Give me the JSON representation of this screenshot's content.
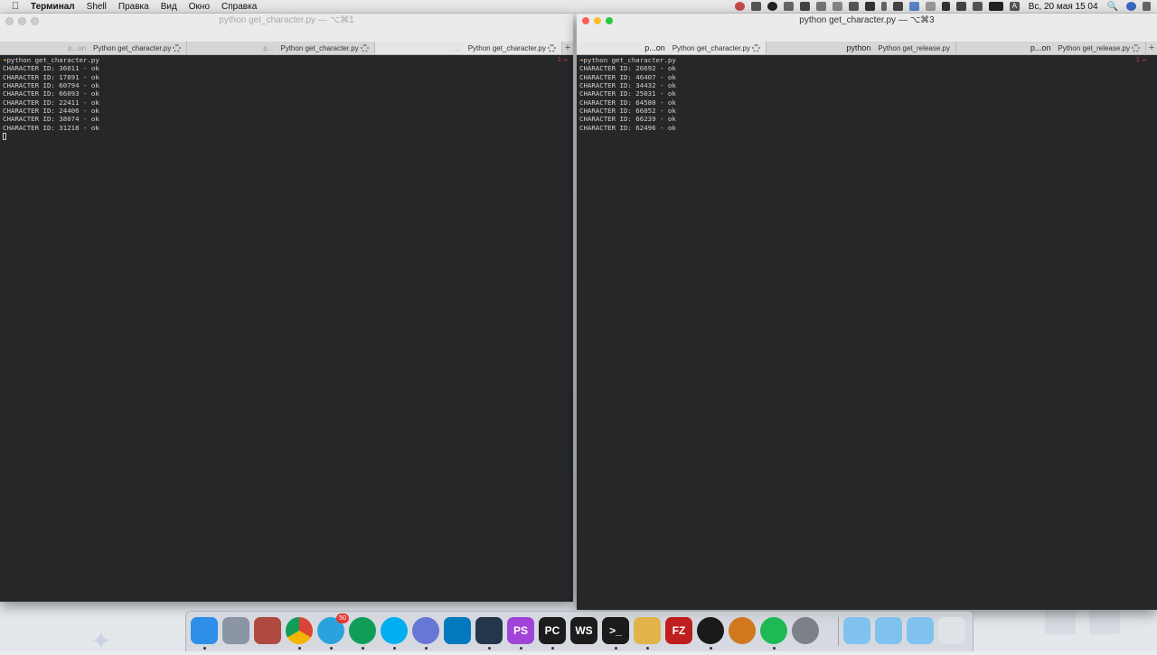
{
  "menubar": {
    "app_name": "Терминал",
    "items": [
      "Shell",
      "Правка",
      "Вид",
      "Окно",
      "Справка"
    ],
    "clock": "Вс, 20 мая  15 04",
    "keyboard_layout": "A"
  },
  "window_left": {
    "title": "python get_character.py — ⌥⌘1",
    "tabs": [
      {
        "short": "p...on",
        "label": "Python get_character.py"
      },
      {
        "short": "p...",
        "label": "Python get_character.py"
      },
      {
        "short": "...",
        "label": "Python get_character.py"
      }
    ],
    "line_number": "1",
    "prompt": "python get_character.py",
    "output": [
      "CHARACTER ID: 36011 - ok",
      "CHARACTER ID: 17891 - ok",
      "CHARACTER ID: 60794 - ok",
      "CHARACTER ID: 66093 - ok",
      "CHARACTER ID: 22411 - ok",
      "CHARACTER ID: 24406 - ok",
      "CHARACTER ID: 38074 - ok",
      "CHARACTER ID: 31218 - ok"
    ]
  },
  "window_right": {
    "title": "python get_character.py — ⌥⌘3",
    "tabs": [
      {
        "short": "p...on",
        "label": "Python get_character.py"
      },
      {
        "short": "python",
        "label": "Python get_release.py"
      },
      {
        "short": "p...on",
        "label": "Python get_release.py"
      }
    ],
    "line_number": "1",
    "prompt": "python get_character.py",
    "output": [
      "CHARACTER ID: 26692 - ok",
      "CHARACTER ID: 46407 - ok",
      "CHARACTER ID: 34432 - ok",
      "CHARACTER ID: 25031 - ok",
      "CHARACTER ID: 64580 - ok",
      "CHARACTER ID: 66852 - ok",
      "CHARACTER ID: 66239 - ok",
      "CHARACTER ID: 62496 - ok"
    ]
  },
  "dock": {
    "telegram_badge": "50",
    "apps": [
      {
        "name": "finder",
        "color": "#2f8fe8"
      },
      {
        "name": "launchpad",
        "color": "#8c95a3"
      },
      {
        "name": "preview-tool",
        "color": "#b04a40"
      },
      {
        "name": "chrome",
        "color": "#f2f2f2"
      },
      {
        "name": "telegram",
        "color": "#2aa3dd"
      },
      {
        "name": "hangouts",
        "color": "#0f9d58"
      },
      {
        "name": "skype",
        "color": "#00aff0"
      },
      {
        "name": "discord",
        "color": "#6677d4"
      },
      {
        "name": "trello",
        "color": "#0079bf"
      },
      {
        "name": "vscode",
        "color": "#24364a"
      },
      {
        "name": "phpstorm",
        "color": "#a044d8"
      },
      {
        "name": "pycharm",
        "color": "#1c1c1c"
      },
      {
        "name": "webstorm",
        "color": "#1c1c1c"
      },
      {
        "name": "terminal",
        "color": "#1b1b1b"
      },
      {
        "name": "sequel",
        "color": "#e1b44a"
      },
      {
        "name": "filezilla",
        "color": "#bf1e1e"
      },
      {
        "name": "media-player",
        "color": "#1a1a1a"
      },
      {
        "name": "audio-app",
        "color": "#d0781e"
      },
      {
        "name": "spotify",
        "color": "#1db954"
      },
      {
        "name": "system-preferences",
        "color": "#7c8087"
      },
      {
        "name": "applications-folder",
        "color": "#7fc2ef"
      },
      {
        "name": "utilities-folder",
        "color": "#7fc2ef"
      },
      {
        "name": "downloads-folder",
        "color": "#7fc2ef"
      },
      {
        "name": "trash",
        "color": "#dfe3e8"
      }
    ],
    "labels": {
      "phpstorm": "PS",
      "pycharm": "PC",
      "webstorm": "WS",
      "terminal": ">_",
      "filezilla": "FZ"
    }
  }
}
